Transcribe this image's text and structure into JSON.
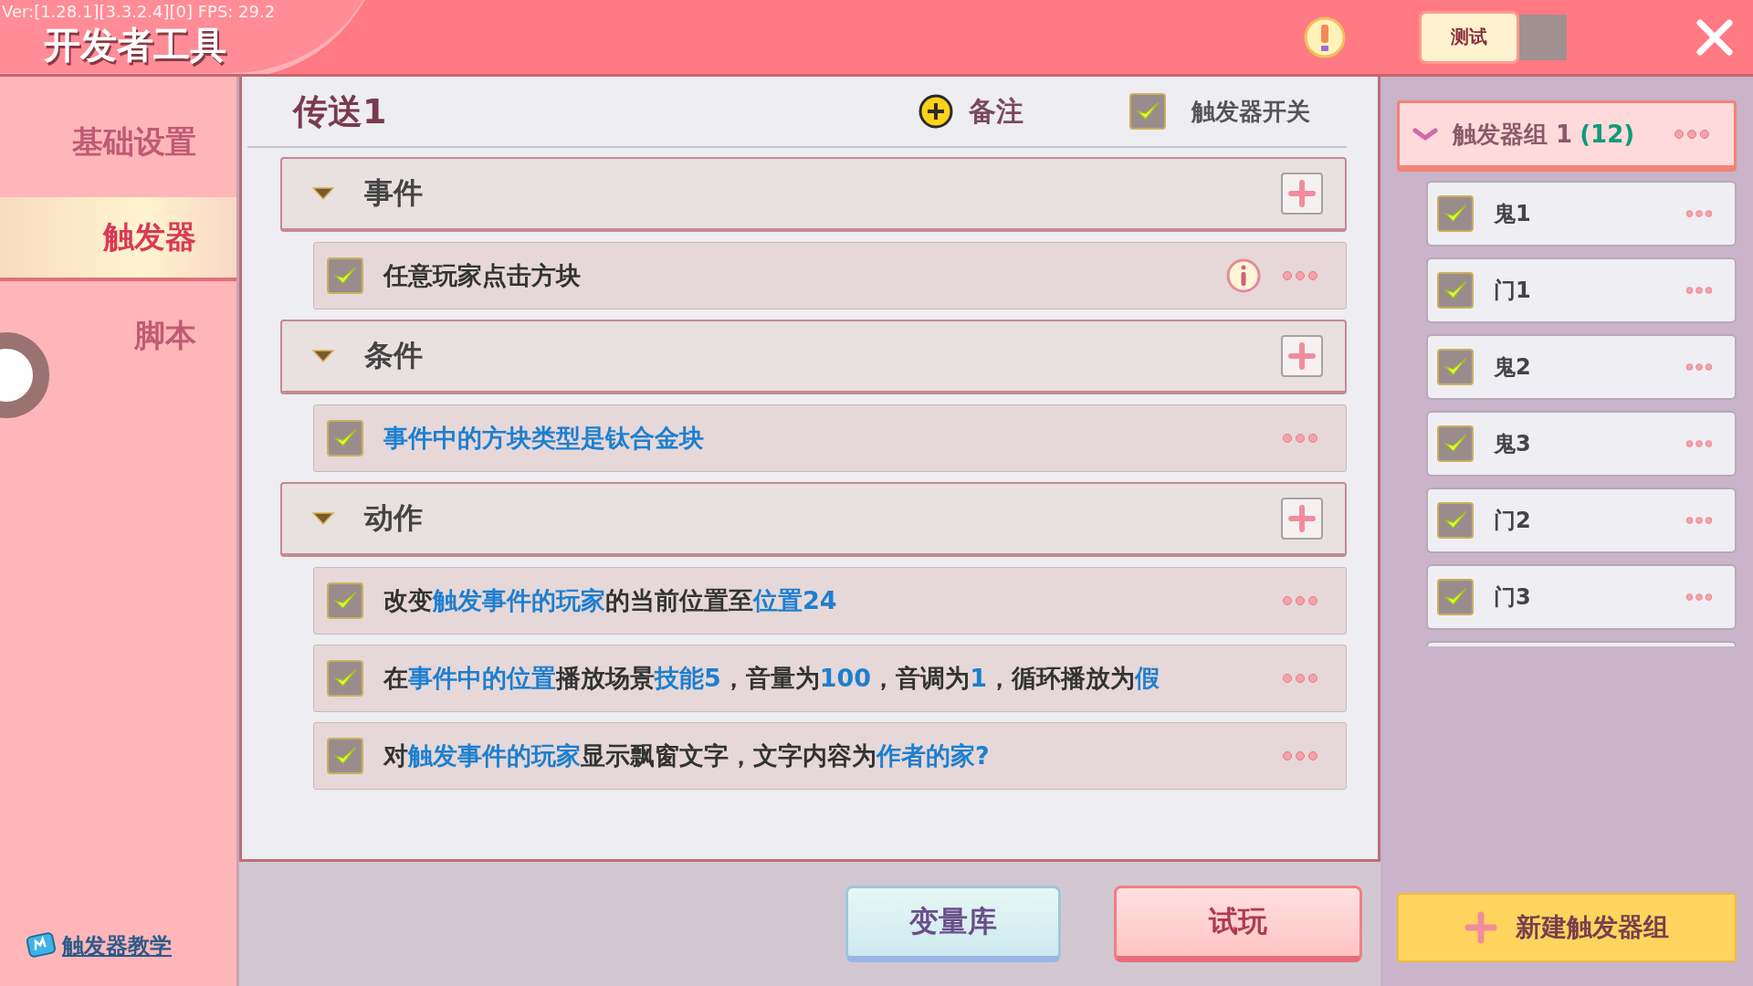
{
  "top_bar": {
    "version": "Ver:[1.28.1][3.3.2.4][0] FPS: 29.2",
    "title": "开发者工具",
    "test_button": "测试"
  },
  "sidebar": {
    "items": [
      {
        "label": "基础设置",
        "selected": false
      },
      {
        "label": "触发器",
        "selected": true
      },
      {
        "label": "脚本",
        "selected": false
      }
    ],
    "tutorial_link": "触发器教学"
  },
  "trigger": {
    "title": "传送1",
    "note_button": "备注",
    "switch": {
      "label": "触发器开关",
      "checked": true
    },
    "sections": [
      {
        "title": "事件",
        "expanded": true,
        "rows": [
          {
            "checked": true,
            "warning": true,
            "segments": [
              {
                "text": "任意玩家点击方块",
                "highlight": false
              }
            ]
          }
        ]
      },
      {
        "title": "条件",
        "expanded": true,
        "rows": [
          {
            "checked": true,
            "warning": false,
            "segments": [
              {
                "text": "事件中的方块类型是钛合金块",
                "highlight": true
              }
            ]
          }
        ]
      },
      {
        "title": "动作",
        "expanded": true,
        "rows": [
          {
            "checked": true,
            "warning": false,
            "segments": [
              {
                "text": "改变",
                "highlight": false
              },
              {
                "text": "触发事件的玩家",
                "highlight": true
              },
              {
                "text": "的当前位置至",
                "highlight": false
              },
              {
                "text": "位置24",
                "highlight": true
              }
            ]
          },
          {
            "checked": true,
            "warning": false,
            "segments": [
              {
                "text": "在",
                "highlight": false
              },
              {
                "text": "事件中的位置",
                "highlight": true
              },
              {
                "text": "播放场景",
                "highlight": false
              },
              {
                "text": "技能5",
                "highlight": true
              },
              {
                "text": "，音量为",
                "highlight": false
              },
              {
                "text": "100",
                "highlight": true
              },
              {
                "text": "，音调为",
                "highlight": false
              },
              {
                "text": "1",
                "highlight": true
              },
              {
                "text": "，循环播放为",
                "highlight": false
              },
              {
                "text": "假",
                "highlight": true
              }
            ]
          },
          {
            "checked": true,
            "warning": false,
            "segments": [
              {
                "text": "对",
                "highlight": false
              },
              {
                "text": "触发事件的玩家",
                "highlight": true
              },
              {
                "text": "显示飘窗文字，文字内容为",
                "highlight": false
              },
              {
                "text": "作者的家?",
                "highlight": true
              }
            ]
          }
        ]
      }
    ]
  },
  "groups": {
    "header": {
      "name": "触发器组 1",
      "count": "(12)",
      "expanded": true
    },
    "items": [
      {
        "label": "鬼1",
        "checked": true
      },
      {
        "label": "门1",
        "checked": true
      },
      {
        "label": "鬼2",
        "checked": true
      },
      {
        "label": "鬼3",
        "checked": true
      },
      {
        "label": "门2",
        "checked": true
      },
      {
        "label": "门3",
        "checked": true
      }
    ],
    "new_group_button": "新建触发器组"
  },
  "bottom_buttons": [
    "变量库",
    "试玩"
  ]
}
